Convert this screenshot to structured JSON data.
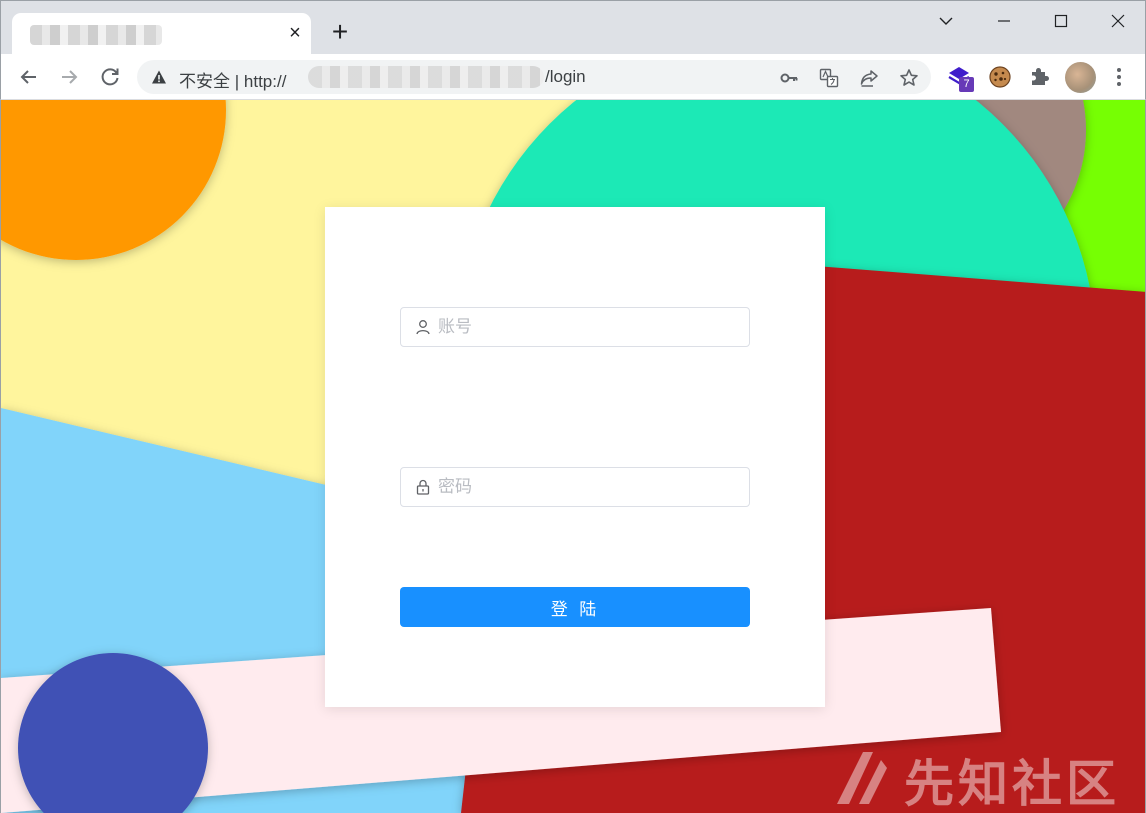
{
  "browser": {
    "tab": {
      "close_symbol": "×"
    },
    "new_tab_symbol": "+",
    "address_bar": {
      "security_label": "不安全",
      "separator": "|",
      "url_prefix": "http://",
      "url_path": "/login"
    },
    "extensions": [
      {
        "icon": "stack-extension-icon",
        "badge": "7"
      },
      {
        "icon": "cookie-extension-icon"
      },
      {
        "icon": "puzzle-extensions-icon"
      }
    ]
  },
  "login": {
    "username_placeholder": "账号",
    "password_placeholder": "密码",
    "submit_label": "登 陆",
    "accent_color": "#1890ff"
  },
  "watermark": {
    "text": "先知社区"
  },
  "background_colors": {
    "orange": "#ff9800",
    "yellow": "#fff59d",
    "teal": "#1de9b6",
    "brown": "#a1887f",
    "lime": "#76ff03",
    "red": "#b71c1c",
    "light_blue": "#81d4fa",
    "pink": "#ffebee",
    "indigo": "#3f51b5"
  }
}
